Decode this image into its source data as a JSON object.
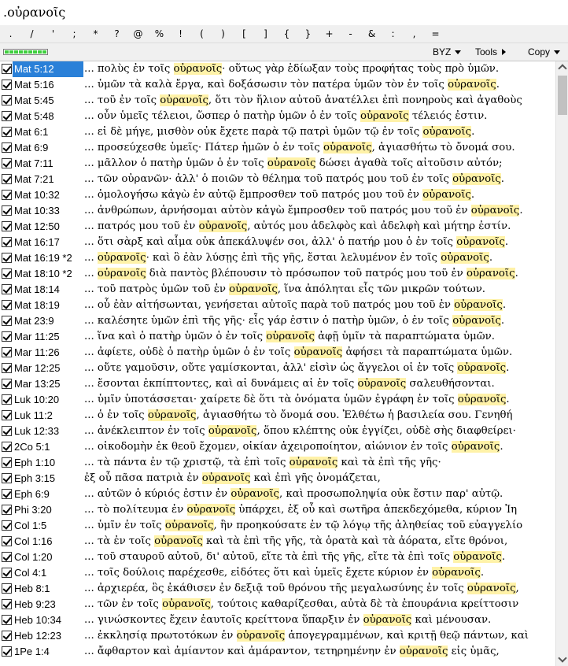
{
  "search": {
    "value": ".οὐρανοῖς"
  },
  "symbols": [
    ".",
    "/",
    "'",
    ";",
    "*",
    "?",
    "@",
    "%",
    "!",
    "(",
    ")",
    "[",
    "]",
    "{",
    "}",
    "+",
    "-",
    "&",
    ":",
    ",",
    "="
  ],
  "toolbar": {
    "progress_segments": 9,
    "version_label": "BYZ",
    "tools_label": "Tools",
    "copy_label": "Copy"
  },
  "results": [
    {
      "ref": "Mat 5:12",
      "pre": "... πολὺς ἐν τοῖς ",
      "hit": "οὐρανοῖς",
      "post": "· οὕτως γὰρ ἐδίωξαν τοὺς προφήτας τοὺς πρὸ ὑμῶν."
    },
    {
      "ref": "Mat 5:16",
      "pre": "... ὑμῶν τὰ καλὰ ἔργα, καὶ δοξάσωσιν τὸν πατέρα ὑμῶν τὸν ἐν τοῖς ",
      "hit": "οὐρανοῖς",
      "post": "."
    },
    {
      "ref": "Mat 5:45",
      "pre": "... τοῦ ἐν τοῖς ",
      "hit": "οὐρανοῖς",
      "post": ", ὅτι τὸν ἥλιον αὐτοῦ ἀνατέλλει ἐπὶ πονηροὺς καὶ ἀγαθοὺς"
    },
    {
      "ref": "Mat 5:48",
      "pre": "... οὖν ὑμεῖς τέλειοι, ὥσπερ ὁ πατὴρ ὑμῶν ὁ ἐν τοῖς ",
      "hit": "οὐρανοῖς",
      "post": " τέλειός ἐστιν."
    },
    {
      "ref": "Mat 6:1",
      "pre": "... εἰ δὲ μήγε, μισθὸν οὐκ ἔχετε παρὰ τῷ πατρὶ ὑμῶν τῷ ἐν τοῖς ",
      "hit": "οὐρανοῖς",
      "post": "."
    },
    {
      "ref": "Mat 6:9",
      "pre": "... προσεύχεσθε ὑμεῖς· Πάτερ ἡμῶν ὁ ἐν τοῖς ",
      "hit": "οὐρανοῖς",
      "post": ", ἁγιασθήτω τὸ ὄνομά σου."
    },
    {
      "ref": "Mat 7:11",
      "pre": "... μᾶλλον ὁ πατὴρ ὑμῶν ὁ ἐν τοῖς ",
      "hit": "οὐρανοῖς",
      "post": " δώσει ἀγαθὰ τοῖς αἰτοῦσιν αὐτόν;"
    },
    {
      "ref": "Mat 7:21",
      "pre": "... τῶν οὐρανῶν· ἀλλ' ὁ ποιῶν τὸ θέλημα τοῦ πατρός μου τοῦ ἐν τοῖς ",
      "hit": "οὐρανοῖς",
      "post": "."
    },
    {
      "ref": "Mat 10:32",
      "pre": "... ὁμολογήσω κἀγὼ ἐν αὐτῷ ἔμπροσθεν τοῦ πατρός μου τοῦ ἐν ",
      "hit": "οὐρανοῖς",
      "post": "."
    },
    {
      "ref": "Mat 10:33",
      "pre": "... ἀνθρώπων, ἀρνήσομαι αὐτὸν κἀγὼ ἔμπροσθεν τοῦ πατρός μου τοῦ ἐν ",
      "hit": "οὐρανοῖς",
      "post": "."
    },
    {
      "ref": "Mat 12:50",
      "pre": "... πατρός μου τοῦ ἐν ",
      "hit": "οὐρανοῖς",
      "post": ", αὐτός μου ἀδελφὸς καὶ ἀδελφὴ καὶ μήτηρ ἐστίν."
    },
    {
      "ref": "Mat 16:17",
      "pre": "... ὅτι σὰρξ καὶ αἷμα οὐκ ἀπεκάλυψέν σοι, ἀλλ' ὁ πατήρ μου ὁ ἐν τοῖς ",
      "hit": "οὐρανοῖς",
      "post": "."
    },
    {
      "ref": "Mat 16:19 *2",
      "pre": "... ",
      "hit": "οὐρανοῖς",
      "post": "· καὶ ὃ ἐὰν λύσῃς ἐπὶ τῆς γῆς, ἔσται λελυμένον ἐν τοῖς ",
      "hit2": "οὐρανοῖς",
      "post2": "."
    },
    {
      "ref": "Mat 18:10 *2",
      "pre": "... ",
      "hit": "οὐρανοῖς",
      "post": " διὰ παντὸς βλέπουσιν τὸ πρόσωπον τοῦ πατρός μου τοῦ ἐν ",
      "hit2": "οὐρανοῖς",
      "post2": "."
    },
    {
      "ref": "Mat 18:14",
      "pre": "... τοῦ πατρὸς ὑμῶν τοῦ ἐν ",
      "hit": "οὐρανοῖς",
      "post": ", ἵνα ἀπόληται εἷς τῶν μικρῶν τούτων."
    },
    {
      "ref": "Mat 18:19",
      "pre": "... οὗ ἐὰν αἰτήσωνται, γενήσεται αὐτοῖς παρὰ τοῦ πατρός μου τοῦ ἐν ",
      "hit": "οὐρανοῖς",
      "post": "."
    },
    {
      "ref": "Mat 23:9",
      "pre": "... καλέσητε ὑμῶν ἐπὶ τῆς γῆς· εἷς γάρ ἐστιν ὁ πατὴρ ὑμῶν, ὁ ἐν τοῖς ",
      "hit": "οὐρανοῖς",
      "post": "."
    },
    {
      "ref": "Mar 11:25",
      "pre": "... ἵνα καὶ ὁ πατὴρ ὑμῶν ὁ ἐν τοῖς ",
      "hit": "οὐρανοῖς",
      "post": " ἀφῇ ὑμῖν τὰ παραπτώματα ὑμῶν."
    },
    {
      "ref": "Mar 11:26",
      "pre": "... ἀφίετε, οὐδὲ ὁ πατὴρ ὑμῶν ὁ ἐν τοῖς ",
      "hit": "οὐρανοῖς",
      "post": " ἀφήσει τὰ παραπτώματα ὑμῶν."
    },
    {
      "ref": "Mar 12:25",
      "pre": "... οὔτε γαμοῦσιν, οὔτε γαμίσκονται, ἀλλ' εἰσὶν ὡς ἄγγελοι οἱ ἐν τοῖς ",
      "hit": "οὐρανοῖς",
      "post": "."
    },
    {
      "ref": "Mar 13:25",
      "pre": "... ἔσονται ἐκπίπτοντες, καὶ αἱ δυνάμεις αἱ ἐν τοῖς ",
      "hit": "οὐρανοῖς",
      "post": " σαλευθήσονται."
    },
    {
      "ref": "Luk 10:20",
      "pre": "... ὑμῖν ὑποτάσσεται· χαίρετε δὲ ὅτι τὰ ὀνόματα ὑμῶν ἐγράφη ἐν τοῖς ",
      "hit": "οὐρανοῖς",
      "post": "."
    },
    {
      "ref": "Luk 11:2",
      "pre": "... ὁ ἐν τοῖς ",
      "hit": "οὐρανοῖς",
      "post": ", ἁγιασθήτω τὸ ὄνομά σου. Ἐλθέτω ἡ βασιλεία σου. Γενηθή"
    },
    {
      "ref": "Luk 12:33",
      "pre": "... ἀνέκλειπτον ἐν τοῖς ",
      "hit": "οὐρανοῖς",
      "post": ", ὅπου κλέπτης οὐκ ἐγγίζει, οὐδὲ σὴς διαφθείρει·"
    },
    {
      "ref": "2Co 5:1",
      "pre": "... οἰκοδομὴν ἐκ θεοῦ ἔχομεν, οἰκίαν ἀχειροποίητον, αἰώνιον ἐν τοῖς ",
      "hit": "οὐρανοῖς",
      "post": "."
    },
    {
      "ref": "Eph 1:10",
      "pre": "... τὰ πάντα ἐν τῷ χριστῷ, τὰ ἐπὶ τοῖς ",
      "hit": "οὐρανοῖς",
      "post": " καὶ τὰ ἐπὶ τῆς γῆς·"
    },
    {
      "ref": "Eph 3:15",
      "pre": "ἐξ οὗ πᾶσα πατριὰ ἐν ",
      "hit": "οὐρανοῖς",
      "post": " καὶ ἐπὶ γῆς ὀνομάζεται,"
    },
    {
      "ref": "Eph 6:9",
      "pre": "... αὐτῶν ὁ κύριός ἐστιν ἐν ",
      "hit": "οὐρανοῖς",
      "post": ", καὶ προσωποληψία οὐκ ἔστιν παρ' αὐτῷ."
    },
    {
      "ref": "Phi 3:20",
      "pre": "... τὸ πολίτευμα ἐν ",
      "hit": "οὐρανοῖς",
      "post": " ὑπάρχει, ἐξ οὗ καὶ σωτῆρα ἀπεκδεχόμεθα, κύριον Ἰη"
    },
    {
      "ref": "Col 1:5",
      "pre": "... ὑμῖν ἐν τοῖς ",
      "hit": "οὐρανοῖς",
      "post": ", ἣν προηκούσατε ἐν τῷ λόγῳ τῆς ἀληθείας τοῦ εὐαγγελίο"
    },
    {
      "ref": "Col 1:16",
      "pre": "... τὰ ἐν τοῖς ",
      "hit": "οὐρανοῖς",
      "post": " καὶ τὰ ἐπὶ τῆς γῆς, τὰ ὁρατὰ καὶ τὰ ἀόρατα, εἴτε θρόνοι,"
    },
    {
      "ref": "Col 1:20",
      "pre": "... τοῦ σταυροῦ αὐτοῦ, δι' αὐτοῦ, εἴτε τὰ ἐπὶ τῆς γῆς, εἴτε τὰ ἐπὶ τοῖς ",
      "hit": "οὐρανοῖς",
      "post": "."
    },
    {
      "ref": "Col 4:1",
      "pre": "... τοῖς δούλοις παρέχεσθε, εἰδότες ὅτι καὶ ὑμεῖς ἔχετε κύριον ἐν ",
      "hit": "οὐρανοῖς",
      "post": "."
    },
    {
      "ref": "Heb 8:1",
      "pre": "... ἀρχιερέα, ὃς ἐκάθισεν ἐν δεξιᾷ τοῦ θρόνου τῆς μεγαλωσύνης ἐν τοῖς ",
      "hit": "οὐρανοῖς",
      "post": ","
    },
    {
      "ref": "Heb 9:23",
      "pre": "... τῶν ἐν τοῖς ",
      "hit": "οὐρανοῖς",
      "post": ", τούτοις καθαρίζεσθαι, αὐτὰ δὲ τὰ ἐπουράνια κρείττοσιν"
    },
    {
      "ref": "Heb 10:34",
      "pre": "... γινώσκοντες ἔχειν ἑαυτοῖς κρείττονα ὕπαρξιν ἐν ",
      "hit": "οὐρανοῖς",
      "post": " καὶ μένουσαν."
    },
    {
      "ref": "Heb 12:23",
      "pre": "... ἐκκλησίᾳ πρωτοτόκων ἐν ",
      "hit": "οὐρανοῖς",
      "post": " ἀπογεγραμμένων, καὶ κριτῇ θεῷ πάντων, καὶ"
    },
    {
      "ref": "1Pe 1:4",
      "pre": "... ἄφθαρτον καὶ ἀμίαντον καὶ ἀμάραντον, τετηρημένην ἐν ",
      "hit": "οὐρανοῖς",
      "post": " εἰς ὑμᾶς,"
    }
  ]
}
